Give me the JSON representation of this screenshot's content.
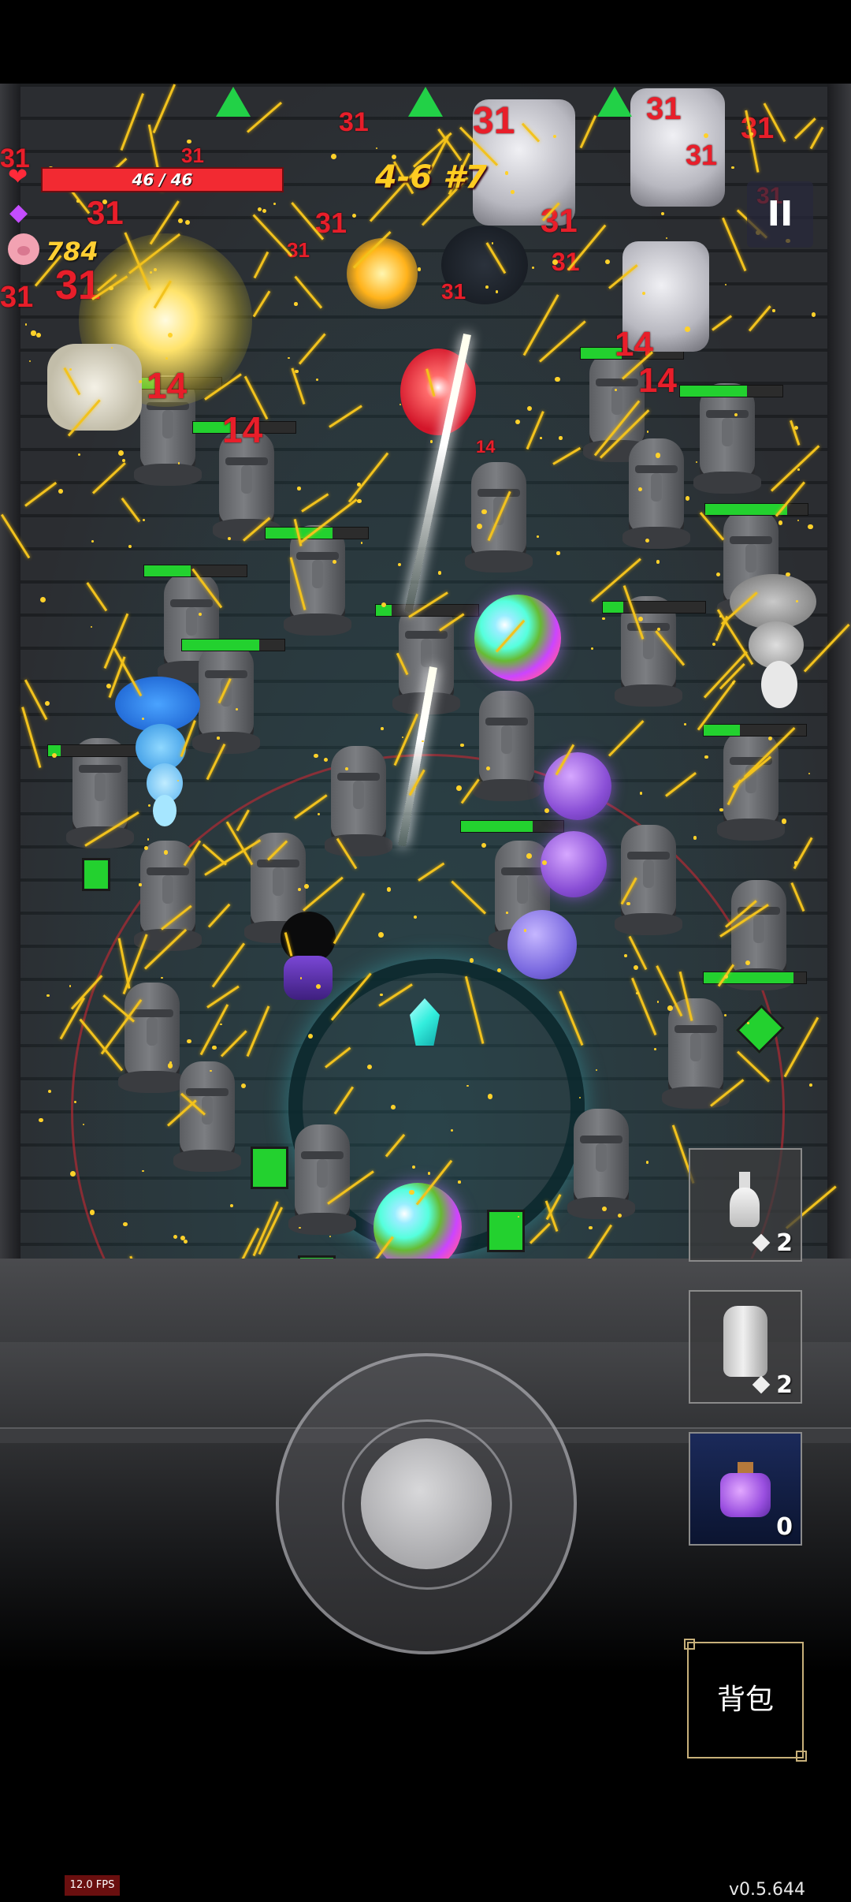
{
  "hud": {
    "hp_text": "46 / 46",
    "hp_fraction": 1.0,
    "coins": "784",
    "stage": "4-6 #7"
  },
  "pause": {
    "label": "II"
  },
  "items": [
    {
      "icon": "potion-bottle-icon",
      "count": "2"
    },
    {
      "icon": "moai-statue-icon",
      "count": "2"
    },
    {
      "icon": "purple-potion-icon",
      "count": "0"
    }
  ],
  "bag": {
    "label": "背包"
  },
  "fps": {
    "text": "12.0 FPS"
  },
  "version": {
    "text": "v0.5.644"
  },
  "damage_numbers": [
    "31",
    "31",
    "31",
    "31",
    "31",
    "31",
    "31",
    "31",
    "31",
    "31",
    "31",
    "31",
    "14",
    "14",
    "14",
    "14",
    "14",
    "31",
    "31",
    "31",
    "31"
  ],
  "colors": {
    "hp_red": "#f22a32",
    "enemy_hp_green": "#23d12f",
    "damage_red": "#e81e2a",
    "arrow_gold": "#f2c21e"
  }
}
